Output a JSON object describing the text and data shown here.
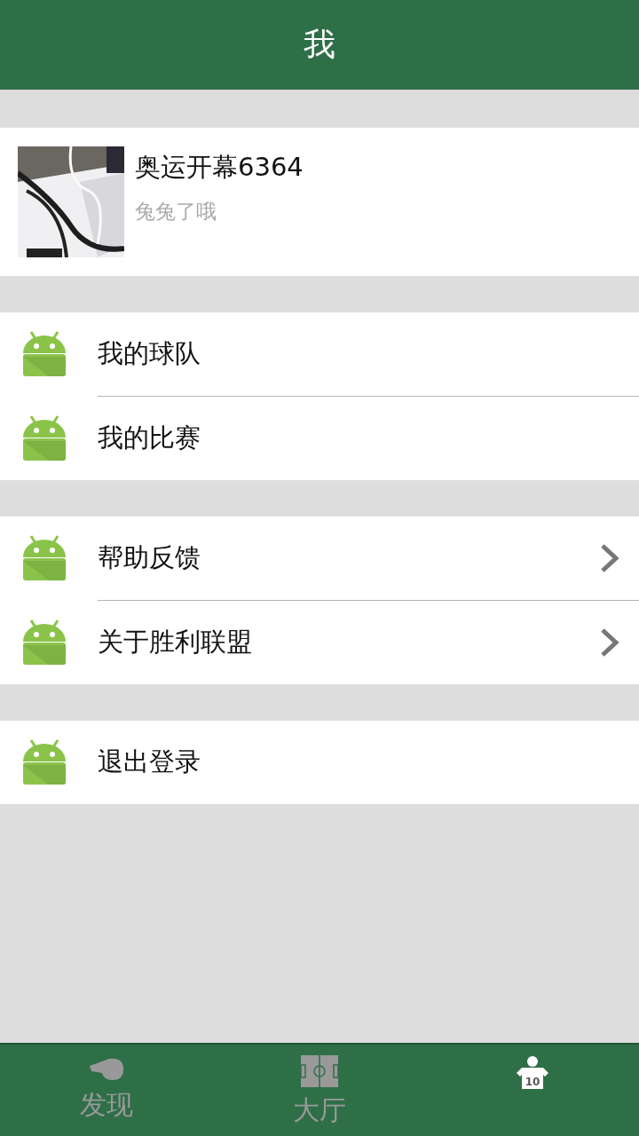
{
  "header": {
    "title": "我"
  },
  "profile": {
    "name": "奥运开幕6364",
    "subtitle": "兔兔了哦"
  },
  "menu_groups": [
    {
      "items": [
        {
          "label": "我的球队",
          "arrow": false
        },
        {
          "label": "我的比赛",
          "arrow": false
        }
      ]
    },
    {
      "items": [
        {
          "label": "帮助反馈",
          "arrow": true
        },
        {
          "label": "关于胜利联盟",
          "arrow": true
        }
      ]
    },
    {
      "items": [
        {
          "label": "退出登录",
          "arrow": false
        }
      ]
    }
  ],
  "tabs": [
    {
      "kind": "whistle",
      "label": "发现",
      "selected": false
    },
    {
      "kind": "field",
      "label": "大厅",
      "selected": false
    },
    {
      "kind": "jersey",
      "number": "10",
      "selected": true
    }
  ]
}
